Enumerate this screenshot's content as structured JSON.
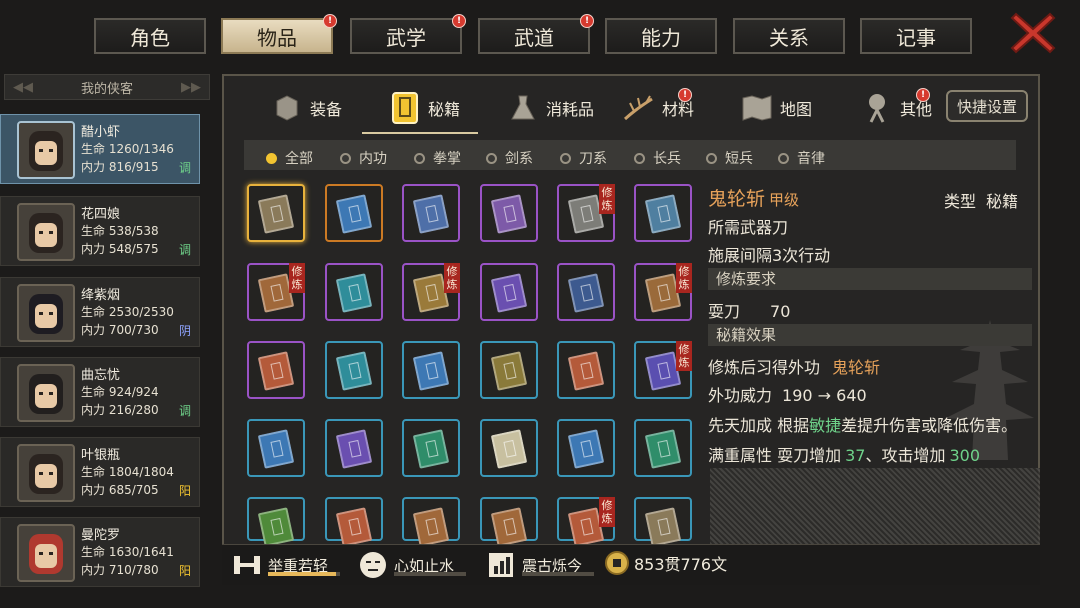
{
  "top_tabs": [
    {
      "label": "角色",
      "active": false,
      "badge": false
    },
    {
      "label": "物品",
      "active": true,
      "badge": true
    },
    {
      "label": "武学",
      "active": false,
      "badge": true
    },
    {
      "label": "武道",
      "active": false,
      "badge": true
    },
    {
      "label": "能力",
      "active": false,
      "badge": false
    },
    {
      "label": "关系",
      "active": false,
      "badge": false
    },
    {
      "label": "记事",
      "active": false,
      "badge": false
    }
  ],
  "badge_mark": "!",
  "left_panel": {
    "header": "我的侠客"
  },
  "heroes": [
    {
      "name": "醋小虾",
      "hp": "生命 1260/1346",
      "mp": "内力 816/915",
      "tag": "调",
      "tag_color": "#6fd28a",
      "active": true
    },
    {
      "name": "花四娘",
      "hp": "生命 538/538",
      "mp": "内力 548/575",
      "tag": "调",
      "tag_color": "#6fd28a",
      "active": false
    },
    {
      "name": "绛紫烟",
      "hp": "生命 2530/2530",
      "mp": "内力 700/730",
      "tag": "阴",
      "tag_color": "#8fa4ff",
      "active": false
    },
    {
      "name": "曲忘忧",
      "hp": "生命 924/924",
      "mp": "内力 216/280",
      "tag": "调",
      "tag_color": "#6fd28a",
      "active": false
    },
    {
      "name": "叶银瓶",
      "hp": "生命 1804/1804",
      "mp": "内力 685/705",
      "tag": "阳",
      "tag_color": "#f2c431",
      "active": false
    },
    {
      "name": "曼陀罗",
      "hp": "生命 1630/1641",
      "mp": "内力 710/780",
      "tag": "阳",
      "tag_color": "#f2c431",
      "active": false
    }
  ],
  "category_tabs": [
    {
      "label": "装备",
      "icon": "armor-icon",
      "badge": false
    },
    {
      "label": "秘籍",
      "icon": "book-icon",
      "badge": false,
      "active": true
    },
    {
      "label": "消耗品",
      "icon": "potion-icon",
      "badge": false
    },
    {
      "label": "材料",
      "icon": "herb-icon",
      "badge": true
    },
    {
      "label": "地图",
      "icon": "map-icon",
      "badge": false
    },
    {
      "label": "其他",
      "icon": "lantern-icon",
      "badge": true
    }
  ],
  "quick_settings": "快捷设置",
  "filters": [
    {
      "label": "全部",
      "selected": true
    },
    {
      "label": "内功",
      "selected": false
    },
    {
      "label": "拳掌",
      "selected": false
    },
    {
      "label": "剑系",
      "selected": false
    },
    {
      "label": "刀系",
      "selected": false
    },
    {
      "label": "长兵",
      "selected": false
    },
    {
      "label": "短兵",
      "selected": false
    },
    {
      "label": "音律",
      "selected": false
    }
  ],
  "train_label": "修炼",
  "grid": [
    [
      {
        "r": "gold",
        "c": "#8a7a5a",
        "t": false
      },
      {
        "r": "orange",
        "c": "#3d78b4",
        "t": false
      },
      {
        "r": "purple",
        "c": "#4e6fa8",
        "t": false
      },
      {
        "r": "purple",
        "c": "#7d5aa8",
        "t": false
      },
      {
        "r": "purple",
        "c": "#7d7d78",
        "t": true
      },
      {
        "r": "purple",
        "c": "#4f7fa0",
        "t": false
      }
    ],
    [
      {
        "r": "purple",
        "c": "#a0683a",
        "t": true
      },
      {
        "r": "purple",
        "c": "#2f8d9a",
        "t": false
      },
      {
        "r": "purple",
        "c": "#9a7a3a",
        "t": true
      },
      {
        "r": "purple",
        "c": "#6a4fb0",
        "t": false
      },
      {
        "r": "purple",
        "c": "#3d5a8f",
        "t": false
      },
      {
        "r": "purple",
        "c": "#9a6a3a",
        "t": true
      }
    ],
    [
      {
        "r": "purple",
        "c": "#b45a3a",
        "t": false
      },
      {
        "r": "blue",
        "c": "#2f8d9a",
        "t": false
      },
      {
        "r": "blue",
        "c": "#3d78b4",
        "t": false
      },
      {
        "r": "blue",
        "c": "#8a7a3a",
        "t": false
      },
      {
        "r": "blue",
        "c": "#b45a3a",
        "t": false
      },
      {
        "r": "blue",
        "c": "#5a4fb0",
        "t": true
      }
    ],
    [
      {
        "r": "blue",
        "c": "#3d78b4",
        "t": false
      },
      {
        "r": "blue",
        "c": "#6a4fb0",
        "t": false
      },
      {
        "r": "blue",
        "c": "#2f8d6a",
        "t": false
      },
      {
        "r": "blue",
        "c": "#c8c0a0",
        "t": false
      },
      {
        "r": "blue",
        "c": "#3d78b4",
        "t": false
      },
      {
        "r": "blue",
        "c": "#2f8d6a",
        "t": false
      }
    ],
    [
      {
        "r": "blue",
        "c": "#4f8a3a",
        "t": false
      },
      {
        "r": "blue",
        "c": "#b45a3a",
        "t": false
      },
      {
        "r": "blue",
        "c": "#a0683a",
        "t": false
      },
      {
        "r": "blue",
        "c": "#a0683a",
        "t": false
      },
      {
        "r": "blue",
        "c": "#b45a3a",
        "t": true
      },
      {
        "r": "blue",
        "c": "#8a7a5a",
        "t": false
      }
    ]
  ],
  "detail": {
    "name": "鬼轮斩",
    "grade": "甲级",
    "type_label": "类型",
    "type_value": "秘籍",
    "weapon": "所需武器刀",
    "interval": "施展间隔3次行动",
    "req_title": "修炼要求",
    "req_skill": "耍刀",
    "req_value": "70",
    "effect_title": "秘籍效果",
    "effect_line1_prefix": "修炼后习得外功",
    "effect_line1_value": "鬼轮斩",
    "power_label": "外功威力",
    "power_value": "190 → 640",
    "innate_prefix": "先天加成 根据",
    "innate_attr": "敏捷",
    "innate_suffix": "差提升伤害或降低伤害。",
    "full_prefix": "满重属性 耍刀增加",
    "full_val1": "37",
    "full_mid": "、攻击增加",
    "full_val2": "300"
  },
  "bottom_bar": {
    "skills": [
      {
        "label": "举重若轻",
        "icon": "strength-icon",
        "progress": 0.95
      },
      {
        "label": "心如止水",
        "icon": "calm-face-icon",
        "progress": 0.0
      },
      {
        "label": "震古烁今",
        "icon": "chart-icon",
        "progress": 0.0
      }
    ],
    "money": "853贯776文"
  },
  "colors": {
    "accent_gold": "#e8b23c",
    "train_red": "#a8261f",
    "positive_green": "#6fd28a"
  }
}
